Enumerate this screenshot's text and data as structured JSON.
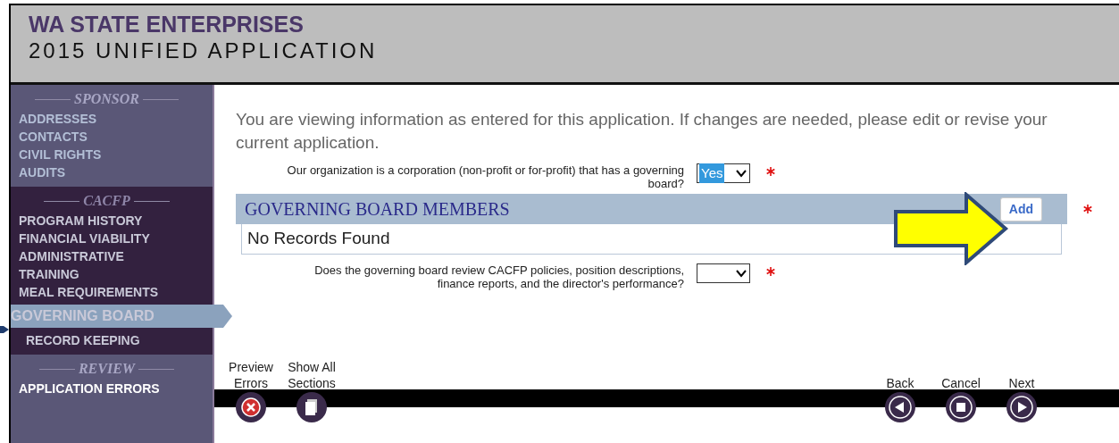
{
  "header": {
    "organization": "WA STATE ENTERPRISES",
    "title": "2015 UNIFIED APPLICATION"
  },
  "sidebar": {
    "sections": [
      {
        "heading": "SPONSOR",
        "kind": "light",
        "items": [
          {
            "label": "ADDRESSES",
            "selected": false
          },
          {
            "label": "CONTACTS",
            "selected": false
          },
          {
            "label": "CIVIL RIGHTS",
            "selected": false
          },
          {
            "label": "AUDITS",
            "selected": false
          }
        ]
      },
      {
        "heading": "CACFP",
        "kind": "dark",
        "items": [
          {
            "label": "PROGRAM HISTORY",
            "selected": false
          },
          {
            "label": "FINANCIAL VIABILITY",
            "selected": false
          },
          {
            "label": "ADMINISTRATIVE",
            "selected": false
          },
          {
            "label": "TRAINING",
            "selected": false
          },
          {
            "label": "MEAL REQUIREMENTS",
            "selected": false
          },
          {
            "label": "GOVERNING BOARD",
            "selected": true
          },
          {
            "label": "RECORD KEEPING",
            "selected": false
          }
        ]
      },
      {
        "heading": "REVIEW",
        "kind": "light",
        "items": [
          {
            "label": "APPLICATION ERRORS",
            "selected": false
          }
        ]
      }
    ]
  },
  "intro": "You are viewing information as entered for this application. If changes are needed, please edit or revise your current application.",
  "questions": [
    {
      "label": "Our organization is a corporation (non-profit or for-profit) that has a governing board?",
      "value": "Yes",
      "required": true
    },
    {
      "label": "Does the governing board review CACFP policies, position descriptions, finance reports, and the director's performance?",
      "required": true
    }
  ],
  "grid": {
    "title": "GOVERNING BOARD MEMBERS",
    "button": "Add",
    "empty_text": "No Records Found",
    "required": true
  },
  "footer": {
    "left": [
      {
        "label": "Preview Errors",
        "kind": "errors"
      },
      {
        "label": "Show All Sections",
        "kind": "pages"
      }
    ],
    "right": [
      {
        "label": "Back",
        "kind": "back"
      },
      {
        "label": "Cancel",
        "kind": "stop"
      },
      {
        "label": "Next",
        "kind": "next"
      }
    ]
  }
}
